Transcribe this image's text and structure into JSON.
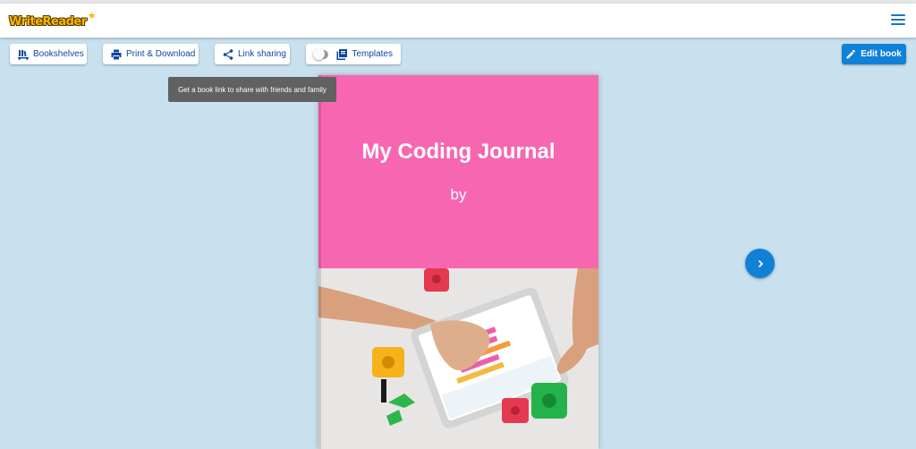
{
  "app": {
    "logo_text": "WriteReader"
  },
  "toolbar": {
    "bookshelves_label": "Bookshelves",
    "print_label": "Print & Download",
    "link_sharing_label": "Link sharing",
    "templates_label": "Templates",
    "edit_label": "Edit book"
  },
  "tooltip": {
    "text": "Get a book link to share with friends and family"
  },
  "book": {
    "title": "My Coding Journal",
    "byline": "by",
    "cover_color": "#f766b0"
  },
  "icons": {
    "menu": "hamburger-icon",
    "bookshelves": "bookshelves-icon",
    "print": "printer-icon",
    "share": "share-icon",
    "templates": "templates-icon",
    "edit": "pencil-icon",
    "next": "chevron-right-icon"
  },
  "colors": {
    "background": "#c9e0ee",
    "accent": "#1181d8",
    "link_text": "#0d47a1"
  }
}
